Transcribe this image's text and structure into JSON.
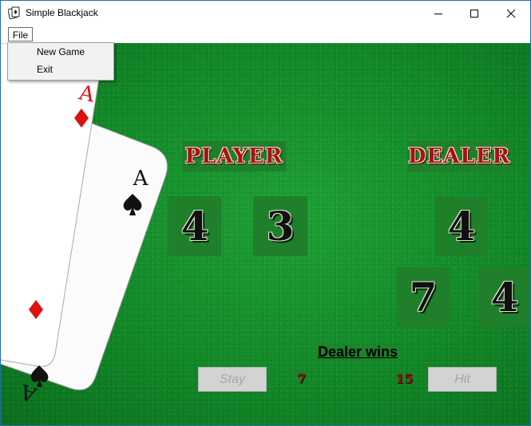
{
  "window": {
    "title": "Simple Blackjack",
    "controls": [
      "minimize",
      "maximize",
      "close"
    ]
  },
  "menu": {
    "file_label": "File",
    "items": [
      {
        "label": "New Game"
      },
      {
        "label": "Exit"
      }
    ]
  },
  "table": {
    "player_label": "PLAYER",
    "dealer_label": "DEALER",
    "player_cards": [
      "4",
      "3"
    ],
    "dealer_cards": [
      "4",
      "7",
      "4"
    ],
    "status": "Dealer wins",
    "player_total": "7",
    "dealer_total": "15",
    "stay_label": "Stay",
    "hit_label": "Hit"
  },
  "decor": {
    "card_ranks": [
      "A",
      "A",
      "A"
    ],
    "card_suits": [
      "diamond",
      "spade",
      "spade"
    ]
  },
  "colors": {
    "felt": "#128a28",
    "label_panel": "#1f7f2a",
    "label_text": "#a3131a",
    "score_text": "#9b1010",
    "disabled_button": "#d3d3d3"
  }
}
